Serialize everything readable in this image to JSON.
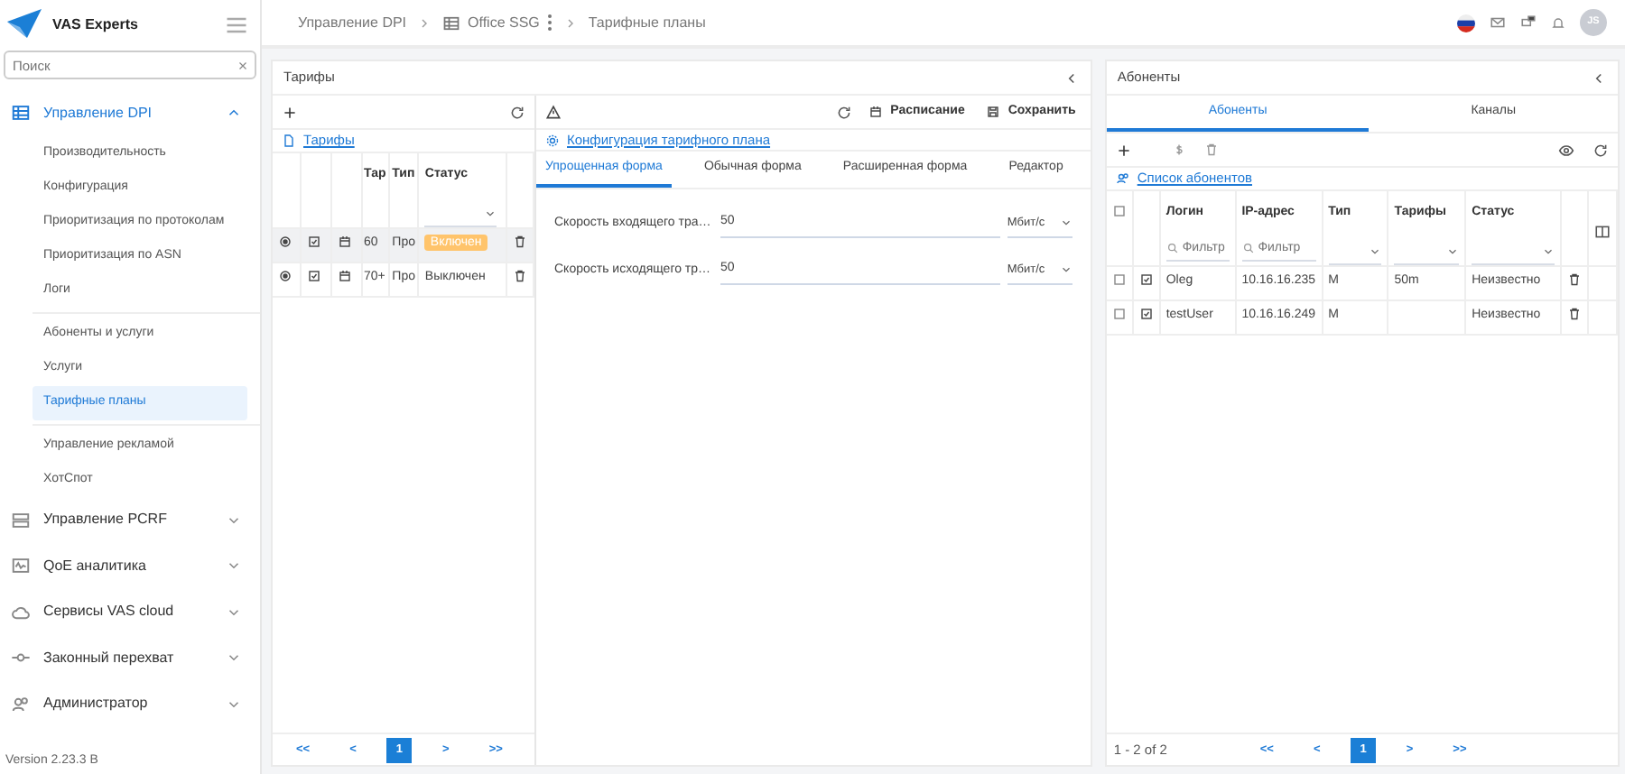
{
  "header": {
    "breadcrumbs": [
      {
        "label": "Управление DPI",
        "kind": "text"
      },
      {
        "label": "Office SSG",
        "kind": "device"
      },
      {
        "label": "Тарифные планы",
        "kind": "text"
      }
    ],
    "avatar": "JS"
  },
  "sidebar": {
    "brand": "VAS Experts",
    "search": {
      "placeholder": "Поиск"
    },
    "groups": [
      {
        "label": "Управление DPI",
        "kind": "grid",
        "expanded": true,
        "sections": [
          {
            "items": [
              {
                "label": "Производительность",
                "selected": false
              },
              {
                "label": "Конфигурация",
                "selected": false
              },
              {
                "label": "Приоритизация по протоколам",
                "selected": false
              },
              {
                "label": "Приоритизация по ASN",
                "selected": false
              },
              {
                "label": "Логи",
                "selected": false
              }
            ]
          },
          {
            "items": [
              {
                "label": "Абоненты и услуги",
                "selected": false
              },
              {
                "label": "Услуги",
                "selected": false
              },
              {
                "label": "Тарифные планы",
                "selected": true
              }
            ]
          },
          {
            "items": [
              {
                "label": "Управление рекламой",
                "selected": false
              },
              {
                "label": "ХотСпот",
                "selected": false
              }
            ]
          }
        ]
      },
      {
        "label": "Управление PCRF",
        "kind": "server",
        "expanded": false
      },
      {
        "label": "QoE аналитика",
        "kind": "monitor",
        "expanded": false
      },
      {
        "label": "Сервисы VAS cloud",
        "kind": "cloud",
        "expanded": false
      },
      {
        "label": "Законный перехват",
        "kind": "node",
        "expanded": false
      },
      {
        "label": "Администратор",
        "kind": "users",
        "expanded": false
      }
    ],
    "version": "Version 2.23.3 B"
  },
  "tariffs": {
    "title": "Тарифы",
    "link": "Тарифы",
    "columns": [
      "Тар",
      "Тип",
      "Статус"
    ],
    "rows": [
      {
        "selected": true,
        "cells": [
          "60",
          "Про"
        ],
        "status": "Включен",
        "enabled": true
      },
      {
        "selected": false,
        "cells": [
          "70+",
          "Про"
        ],
        "status": "Выключен",
        "enabled": false
      }
    ],
    "pagination": [
      {
        "label": "<<",
        "selected": false
      },
      {
        "label": "<",
        "selected": false
      },
      {
        "label": "1",
        "selected": true
      },
      {
        "label": ">",
        "selected": false
      },
      {
        "label": ">>",
        "selected": false
      }
    ]
  },
  "config": {
    "link": "Конфигурация тарифного плана",
    "actions": [
      {
        "label": "Расписание",
        "kind": "calendar"
      },
      {
        "label": "Сохранить",
        "kind": "save"
      }
    ],
    "tabs": [
      {
        "label": "Упрощенная форма",
        "selected": true
      },
      {
        "label": "Обычная форма",
        "selected": false
      },
      {
        "label": "Расширенная форма",
        "selected": false
      },
      {
        "label": "Редактор",
        "selected": false
      }
    ],
    "fields": [
      {
        "label": "Скорость входящего тра…",
        "value": "50",
        "unit": "Мбит/с"
      },
      {
        "label": "Скорость исходящего тр…",
        "value": "50",
        "unit": "Мбит/с"
      }
    ]
  },
  "subscribers": {
    "title": "Абоненты",
    "tabs": [
      {
        "label": "Абоненты",
        "selected": true
      },
      {
        "label": "Каналы",
        "selected": false
      }
    ],
    "link": "Список абонентов",
    "columns": [
      {
        "label": "Логин",
        "kind": "text",
        "placeholder": "Фильтр"
      },
      {
        "label": "IP-адрес",
        "kind": "text",
        "placeholder": "Фильтр"
      },
      {
        "label": "Тип",
        "kind": "select"
      },
      {
        "label": "Тарифы",
        "kind": "select"
      },
      {
        "label": "Статус",
        "kind": "select"
      }
    ],
    "rows": [
      {
        "checked": false,
        "cells": [
          "Oleg",
          "10.16.16.235",
          "M",
          "50m",
          "Неизвестно"
        ]
      },
      {
        "checked": false,
        "cells": [
          "testUser",
          "10.16.16.249",
          "M",
          null,
          "Неизвестно"
        ]
      }
    ],
    "summary": "1 - 2 of 2",
    "pagination": [
      {
        "label": "<<",
        "selected": false
      },
      {
        "label": "<",
        "selected": false
      },
      {
        "label": "1",
        "selected": true
      },
      {
        "label": ">",
        "selected": false
      },
      {
        "label": ">>",
        "selected": false
      }
    ]
  }
}
